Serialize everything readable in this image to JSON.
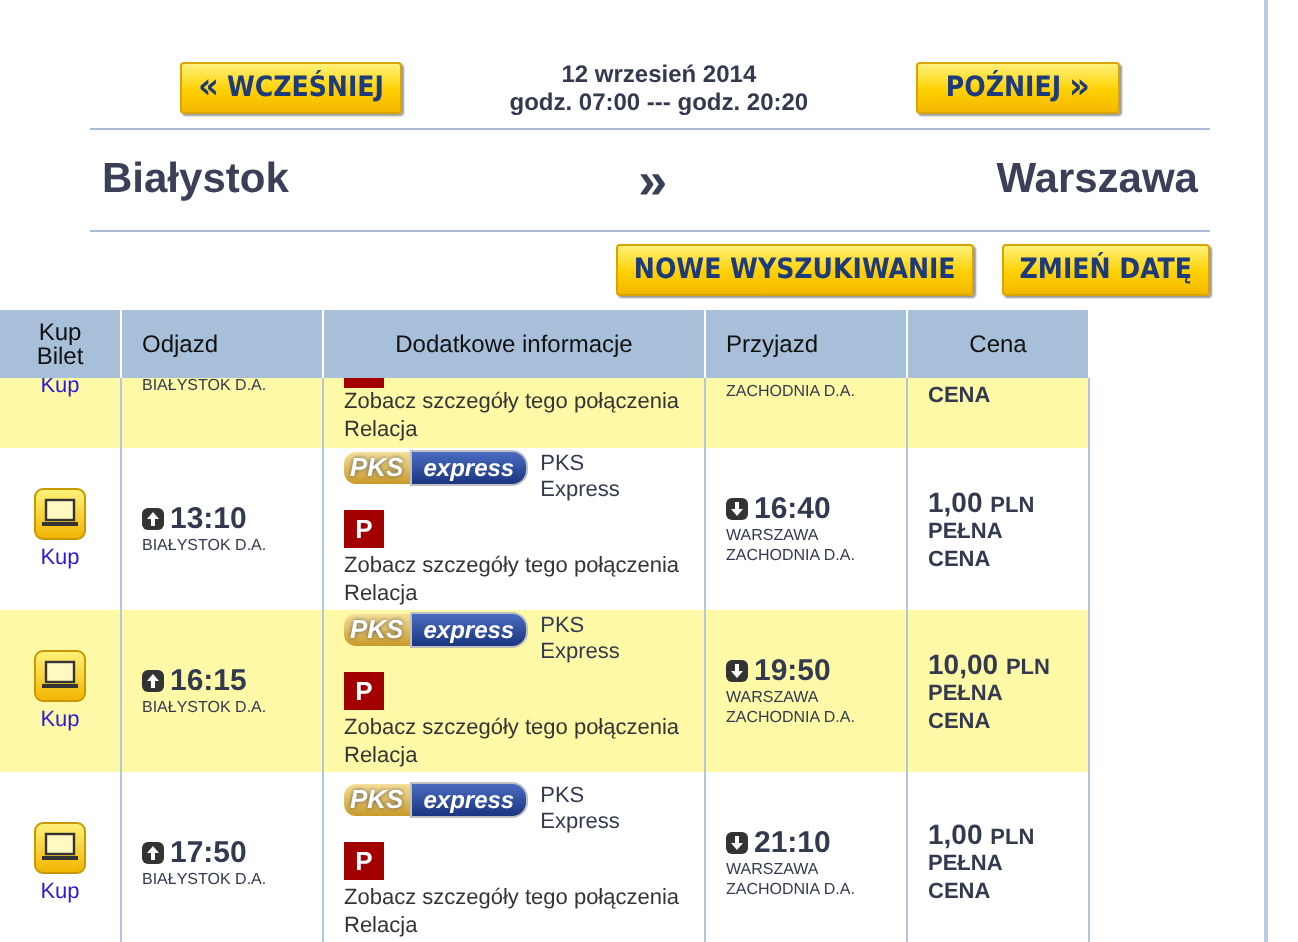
{
  "nav": {
    "earlier": {
      "arrow": "«",
      "label": "WCZEŚNIEJ"
    },
    "later": {
      "label": "POŹNIEJ",
      "arrow": "»"
    },
    "date": "12 wrzesień 2014",
    "hours": "godz. 07:00 --- godz. 20:20"
  },
  "route": {
    "from": "Białystok",
    "separator": "»",
    "to": "Warszawa"
  },
  "actions": [
    "NOWE WYSZUKIWANIE",
    "ZMIEŃ DATĘ"
  ],
  "table": {
    "columns": [
      "Kup Bilet",
      "Odjazd",
      "Dodatkowe informacje",
      "Przyjazd",
      "Cena"
    ],
    "partial_row": {
      "buy": "Kup",
      "station_dep": "BIAŁYSTOK D.A.",
      "details_link": "Zobacz szczegóły tego połączenia",
      "route_link": "Relacja",
      "station_arr": "ZACHODNIA D.A.",
      "fare": "CENA",
      "highlighted": true
    },
    "rows": [
      {
        "buy": "Kup",
        "time_dep": "13:10",
        "station_dep": "BIAŁYSTOK D.A.",
        "logo": [
          "PKS",
          "express"
        ],
        "carrier": "PKS Express",
        "p": "P",
        "details_link": "Zobacz szczegóły tego połączenia",
        "route_link": "Relacja",
        "time_arr": "16:40",
        "station_arr": "WARSZAWA ZACHODNIA D.A.",
        "price": "1,00",
        "currency": "PLN",
        "fare": "PEŁNA CENA",
        "highlighted": false
      },
      {
        "buy": "Kup",
        "time_dep": "16:15",
        "station_dep": "BIAŁYSTOK D.A.",
        "logo": [
          "PKS",
          "express"
        ],
        "carrier": "PKS Express",
        "p": "P",
        "details_link": "Zobacz szczegóły tego połączenia",
        "route_link": "Relacja",
        "time_arr": "19:50",
        "station_arr": "WARSZAWA ZACHODNIA D.A.",
        "price": "10,00",
        "currency": "PLN",
        "fare": "PEŁNA CENA",
        "highlighted": true
      },
      {
        "buy": "Kup",
        "time_dep": "17:50",
        "station_dep": "BIAŁYSTOK D.A.",
        "logo": [
          "PKS",
          "express"
        ],
        "carrier": "PKS Express",
        "p": "P",
        "details_link": "Zobacz szczegóły tego połączenia",
        "route_link": "Relacja",
        "time_arr": "21:10",
        "station_arr": "WARSZAWA ZACHODNIA D.A.",
        "price": "1,00",
        "currency": "PLN",
        "fare": "PEŁNA CENA",
        "highlighted": false
      }
    ]
  }
}
